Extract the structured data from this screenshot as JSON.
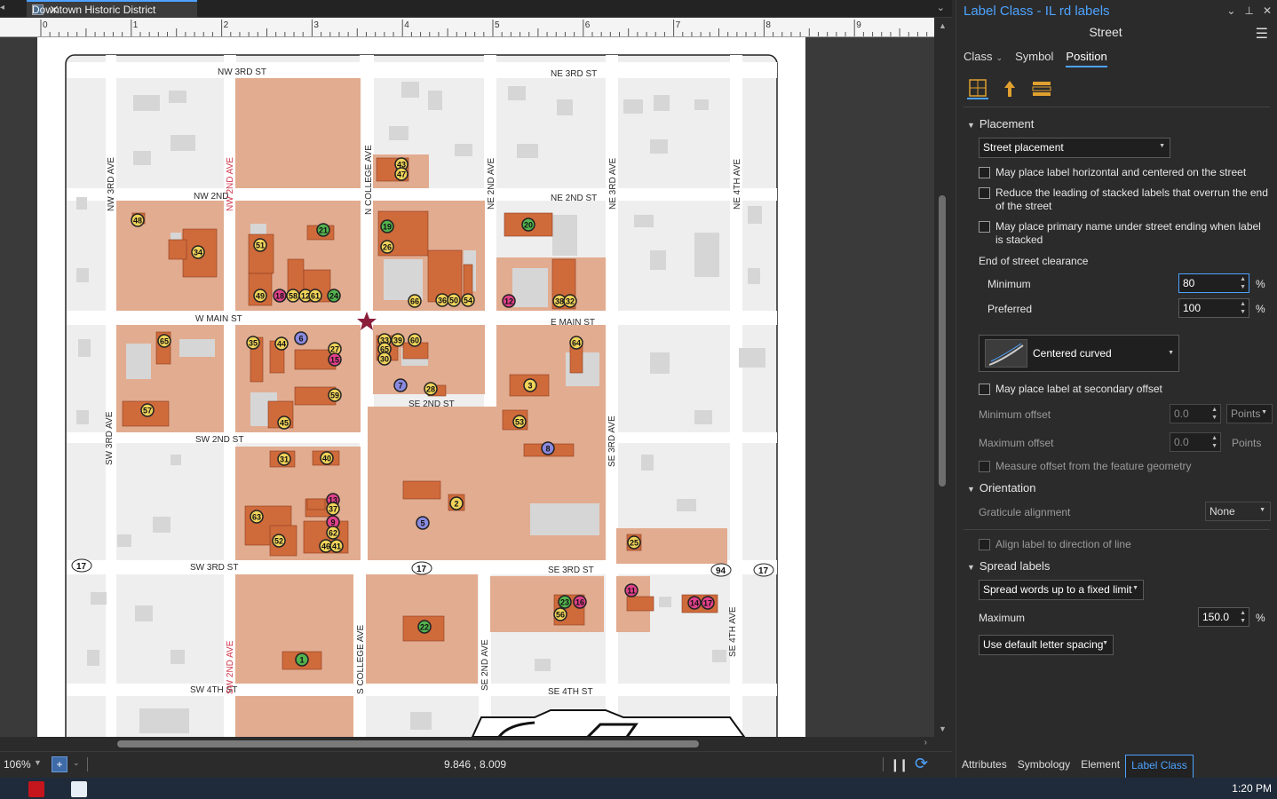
{
  "map_tab": {
    "title": "Downtown Historic District"
  },
  "ruler": {
    "ticks": [
      "0",
      "1",
      "2",
      "3",
      "4",
      "5",
      "6",
      "7",
      "8",
      "9"
    ]
  },
  "map": {
    "streets": {
      "nw_3rd_st": "NW 3RD ST",
      "ne_3rd_st": "NE 3RD ST",
      "nw_2nd": "NW 2ND",
      "ne_2nd_st": "NE 2ND ST",
      "nw_3rd_ave": "NW 3RD AVE",
      "nw_2nd_ave": "NW 2ND AVE",
      "n_college_ave": "N COLLEGE AVE",
      "ne_2nd_ave": "NE 2ND AVE",
      "ne_3rd_ave": "NE 3RD AVE",
      "ne_4th_ave": "NE 4TH AVE",
      "w_main_st": "W MAIN ST",
      "e_main_st": "E MAIN ST",
      "se_2nd_st": "SE 2ND ST",
      "sw_2nd_st": "SW 2ND ST",
      "sw_3rd_ave": "SW 3RD AVE",
      "se_3rd_ave": "SE 3RD AVE",
      "sw_3rd_st": "SW 3RD ST",
      "se_3rd_st": "SE 3RD ST",
      "sw_4th_st": "SW 4TH ST",
      "se_4th_st": "SE 4TH ST",
      "sw_2nd_ave": "SW 2ND AVE",
      "s_college_ave": "S COLLEGE AVE",
      "se_2nd_ave": "SE 2ND AVE",
      "se_4th_ave": "SE 4TH AVE"
    },
    "route_shields": [
      "17",
      "17",
      "94",
      "17"
    ],
    "markers": [
      "48",
      "34",
      "51",
      "21",
      "49",
      "18",
      "58",
      "12",
      "61",
      "24",
      "43",
      "47",
      "19",
      "26",
      "66",
      "36",
      "50",
      "54",
      "20",
      "12",
      "38",
      "32",
      "65",
      "35",
      "44",
      "6",
      "27",
      "15",
      "33",
      "39",
      "60",
      "65",
      "30",
      "64",
      "7",
      "28",
      "59",
      "57",
      "45",
      "3",
      "53",
      "31",
      "40",
      "8",
      "13",
      "37",
      "9",
      "63",
      "52",
      "62",
      "46",
      "41",
      "2",
      "5",
      "25",
      "11",
      "23",
      "16",
      "56",
      "22",
      "14",
      "17",
      "1"
    ],
    "colors": {
      "parcel": "#e2ac90",
      "building": "#cf6a3b",
      "road": "#ffffff",
      "background": "#eeeeee",
      "gray_building": "#d6d6d6"
    }
  },
  "status": {
    "zoom": "106%",
    "coords": "9.846 , 8.009"
  },
  "taskbar": {
    "clock": "1:20 PM"
  },
  "panel": {
    "title": "Label Class - IL rd labels",
    "subtitle": "Street",
    "tabs": [
      "Class",
      "Symbol",
      "Position"
    ],
    "active_tab": "Position",
    "placement": {
      "header": "Placement",
      "dropdown": "Street placement",
      "checks": [
        "May place label horizontal and centered on the street",
        "Reduce the leading of stacked labels that overrun the end of the street",
        "May place primary name under street ending when label is stacked"
      ],
      "end_clearance": "End of street clearance",
      "minimum_label": "Minimum",
      "minimum_value": "80",
      "preferred_label": "Preferred",
      "preferred_value": "100",
      "percent": "%",
      "curve_style": "Centered curved",
      "secondary_offset": "May place label at secondary offset",
      "min_offset_label": "Minimum offset",
      "min_offset_value": "0.0",
      "units": "Points",
      "max_offset_label": "Maximum offset",
      "max_offset_value": "0.0",
      "measure_offset": "Measure offset from the feature geometry"
    },
    "orientation": {
      "header": "Orientation",
      "graticule_label": "Graticule alignment",
      "graticule_value": "None",
      "align_direction": "Align label to direction of line"
    },
    "spread": {
      "header": "Spread labels",
      "dropdown": "Spread words up to a fixed limit",
      "maximum_label": "Maximum",
      "maximum_value": "150.0",
      "letter_spacing": "Use default letter spacing"
    },
    "bottom_tabs": [
      "Attributes",
      "Symbology",
      "Element",
      "Label Class"
    ],
    "active_bottom_tab": "Label Class"
  }
}
